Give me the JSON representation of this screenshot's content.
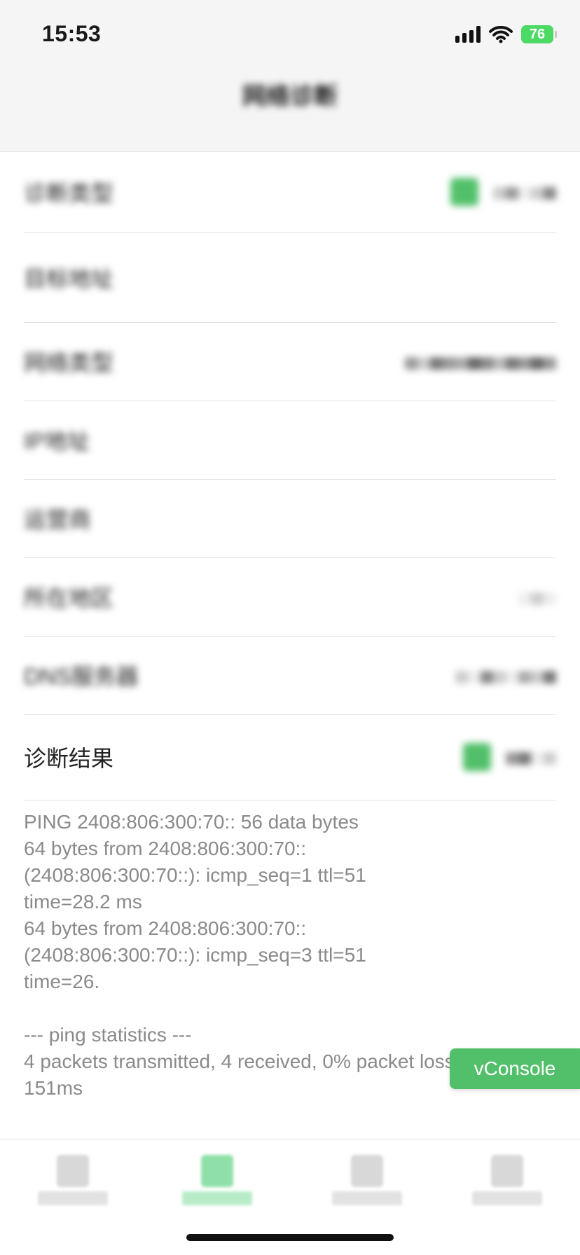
{
  "status_bar": {
    "time": "15:53",
    "battery": "76"
  },
  "nav": {
    "title": "网络诊断"
  },
  "rows": [
    {
      "label": "诊断类型",
      "value": ""
    },
    {
      "label": "目标地址",
      "value": ""
    },
    {
      "label": "网络类型",
      "value": ""
    },
    {
      "label": "IP地址",
      "value": ""
    },
    {
      "label": "运营商",
      "value": ""
    },
    {
      "label": "所在地区",
      "value": ""
    },
    {
      "label": "DNS服务器",
      "value": ""
    },
    {
      "label": "诊断结果",
      "value": ""
    }
  ],
  "result_text": "PING 2408:806:300:70:: 56 data bytes\n64 bytes from 2408:806:300:70::\n(2408:806:300:70::): icmp_seq=1 ttl=51\ntime=28.2 ms\n64 bytes from 2408:806:300:70::\n(2408:806:300:70::): icmp_seq=3 ttl=51\ntime=26.\n\n--- ping statistics ---\n4 packets transmitted, 4 received, 0% packet loss, time\n151ms",
  "vconsole": {
    "label": "vConsole"
  },
  "tabs": [
    {
      "name": "tab-1"
    },
    {
      "name": "tab-2"
    },
    {
      "name": "tab-3"
    },
    {
      "name": "tab-4"
    }
  ],
  "colors": {
    "accent": "#52c06a",
    "background": "#f5f5f5"
  }
}
